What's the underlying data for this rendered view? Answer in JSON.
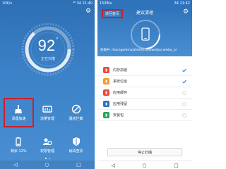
{
  "left": {
    "status": {
      "carrier": "10K/s",
      "right": "⁴⁶ 34 21:40"
    },
    "score": "92",
    "score_unit": "°",
    "score_label": "正在扫描",
    "tiles": [
      {
        "icon": "broom-icon",
        "label": "清理加速",
        "highlighted": true
      },
      {
        "icon": "traffic-icon",
        "label": "流量管理",
        "highlighted": false
      },
      {
        "icon": "block-icon",
        "label": "骚扰拦截",
        "highlighted": false
      },
      {
        "icon": "battery-icon",
        "label": "剩余 12%",
        "highlighted": false
      },
      {
        "icon": "permission-icon",
        "label": "权限管理",
        "highlighted": false
      },
      {
        "icon": "shield-icon",
        "label": "病毒查杀",
        "highlighted": false
      }
    ]
  },
  "right": {
    "status": {
      "carrier": "150B/s",
      "right": "34 21:42"
    },
    "back_label": "返回首页",
    "title": "建议清理",
    "scan_path": "扫描中: /storage/emulated/0/sina/weibo/.weibo_pi",
    "rows": [
      {
        "label": "内存加速",
        "color": "#e94c3d",
        "checked": true
      },
      {
        "label": "系统垃圾",
        "color": "#f39c2b",
        "checked": true
      },
      {
        "label": "应用缓存",
        "color": "#e94c3d",
        "checked": false
      },
      {
        "label": "应用残留",
        "color": "#2f73bb",
        "checked": false
      },
      {
        "label": "安装包",
        "color": "#27a85a",
        "checked": false
      }
    ],
    "stop_label": "停止扫描"
  },
  "colors": {
    "accent": "#2f73bb",
    "highlight": "#cc1f2d"
  }
}
